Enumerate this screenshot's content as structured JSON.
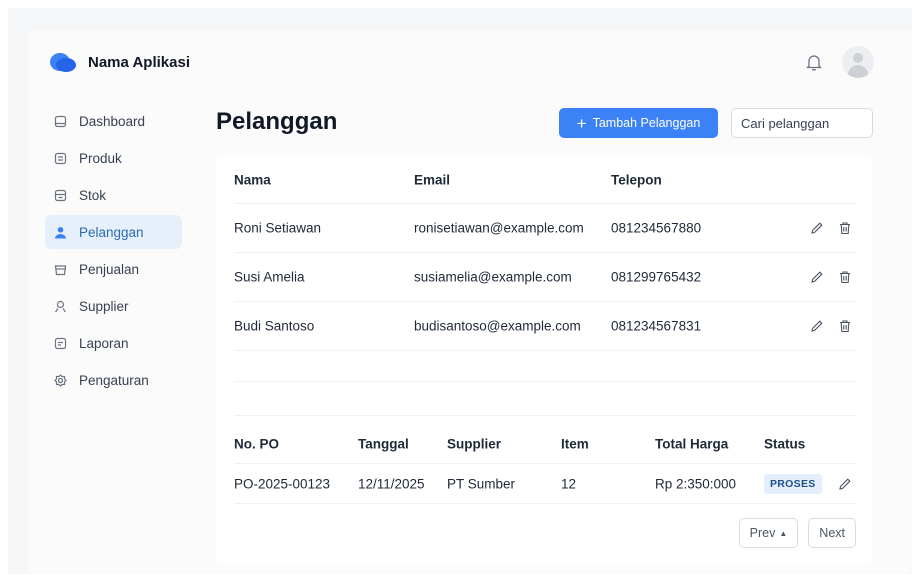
{
  "app": {
    "name": "Nama Aplikasi"
  },
  "colors": {
    "primary": "#3b82f6",
    "active_bg": "#e6f0fb",
    "active_text": "#2b6cb0"
  },
  "header": {
    "notification_icon": "bell-icon",
    "avatar_icon": "user-avatar"
  },
  "sidebar": {
    "items": [
      {
        "label": "Dashboard",
        "icon": "dashboard-icon",
        "active": false
      },
      {
        "label": "Produk",
        "icon": "box-icon",
        "active": false
      },
      {
        "label": "Stok",
        "icon": "inventory-icon",
        "active": false
      },
      {
        "label": "Pelanggan",
        "icon": "person-icon",
        "active": true
      },
      {
        "label": "Penjualan",
        "icon": "cart-icon",
        "active": false
      },
      {
        "label": "Supplier",
        "icon": "supplier-icon",
        "active": false
      },
      {
        "label": "Laporan",
        "icon": "report-icon",
        "active": false
      },
      {
        "label": "Pengaturan",
        "icon": "gear-icon",
        "active": false
      }
    ]
  },
  "page": {
    "title": "Pelanggan",
    "add_button": "Tambah Pelanggan",
    "add_icon": "+",
    "search_placeholder": "Cari pelanggan"
  },
  "customers": {
    "columns": {
      "name": "Nama",
      "email": "Email",
      "phone": "Telepon"
    },
    "rows": [
      {
        "name": "Roni Setiawan",
        "email": "ronisetiawan@example.com",
        "phone": "081234567880"
      },
      {
        "name": "Susi Amelia",
        "email": "susiamelia@example.com",
        "phone": "081299765432"
      },
      {
        "name": "Budi Santoso",
        "email": "budisantoso@example.com",
        "phone": "081234567831"
      }
    ]
  },
  "purchase_orders": {
    "columns": {
      "no": "No. PO",
      "date": "Tanggal",
      "supplier": "Supplier",
      "item": "Item",
      "total": "Total Harga",
      "status": "Status"
    },
    "rows": [
      {
        "no": "PO-2025-00123",
        "date": "12/11/2025",
        "supplier": "PT Sumber",
        "item": "12",
        "total": "Rp 2:350:000",
        "status": "PROSES"
      }
    ]
  },
  "pagination": {
    "prev": "Prev",
    "next": "Next"
  }
}
